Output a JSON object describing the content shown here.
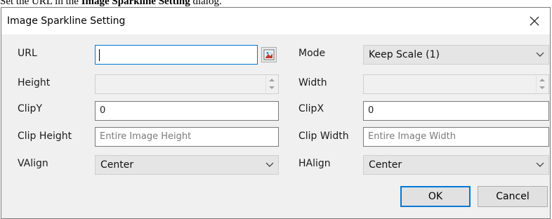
{
  "caption": {
    "prefix": "Set the URL in the ",
    "bold": "Image Sparkline Setting",
    "suffix": " dialog."
  },
  "dialog": {
    "title": "Image Sparkline Setting",
    "close_icon": "close-icon",
    "accent_color": "#0078d7"
  },
  "fields": {
    "url": {
      "label": "URL",
      "value": ""
    },
    "mode": {
      "label": "Mode",
      "selected": "Keep Scale (1)"
    },
    "height": {
      "label": "Height",
      "value": ""
    },
    "width": {
      "label": "Width",
      "value": ""
    },
    "clipy": {
      "label": "ClipY",
      "value": "0"
    },
    "clipx": {
      "label": "ClipX",
      "value": "0"
    },
    "clip_height": {
      "label": "Clip Height",
      "placeholder": "Entire Image Height"
    },
    "clip_width": {
      "label": "Clip Width",
      "placeholder": "Entire Image Width"
    },
    "valign": {
      "label": "VAlign",
      "selected": "Center"
    },
    "halign": {
      "label": "HAlign",
      "selected": "Center"
    }
  },
  "buttons": {
    "ok": "OK",
    "cancel": "Cancel"
  }
}
